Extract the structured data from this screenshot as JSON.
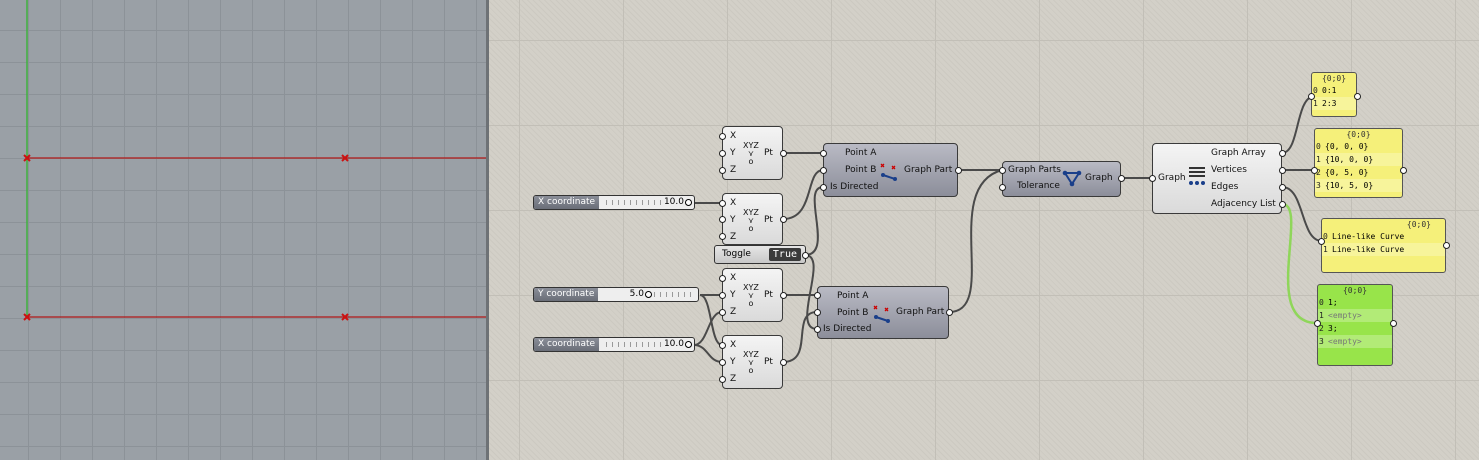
{
  "viewport": {
    "axis_color": "#3fb13f",
    "curve_color": "#b01818",
    "point_color": "#cc1111"
  },
  "sliders": [
    {
      "label": "X coordinate",
      "value": "10.0"
    },
    {
      "label": "Y coordinate",
      "value": "5.0"
    },
    {
      "label": "X coordinate",
      "value": "10.0"
    }
  ],
  "toggle": {
    "label": "Toggle",
    "value": "True"
  },
  "pt_nodes": {
    "inputs": [
      "X",
      "Y",
      "Z"
    ],
    "output": "Pt"
  },
  "graph_part_a": {
    "inputs": [
      "Point A",
      "Point B",
      "Is Directed"
    ],
    "output": "Graph Part"
  },
  "graph_part_b": {
    "inputs": [
      "Point A",
      "Point B",
      "Is Directed"
    ],
    "output": "Graph Part"
  },
  "graph_node": {
    "inputs": [
      "Graph Parts",
      "Tolerance"
    ],
    "output": "Graph"
  },
  "deconstruct": {
    "input": "Graph",
    "outputs": [
      "Graph Array",
      "Vertices",
      "Edges",
      "Adjacency List"
    ]
  },
  "panels": {
    "graph_array": {
      "header": "{0;0}",
      "rows": [
        {
          "i": "0",
          "v": "0:1"
        },
        {
          "i": "1",
          "v": "2:3"
        }
      ]
    },
    "vertices": {
      "header": "{0;0}",
      "rows": [
        {
          "i": "0",
          "v": "{0, 0, 0}"
        },
        {
          "i": "1",
          "v": "{10, 0, 0}"
        },
        {
          "i": "2",
          "v": "{0, 5, 0}"
        },
        {
          "i": "3",
          "v": "{10, 5, 0}"
        }
      ]
    },
    "edges": {
      "header": "{0;0}",
      "rows": [
        {
          "i": "0",
          "v": "Line-like Curve"
        },
        {
          "i": "1",
          "v": "Line-like Curve"
        }
      ]
    },
    "adjacency": {
      "header": "{0;0}",
      "rows": [
        {
          "i": "0",
          "v": "1;"
        },
        {
          "i": "1",
          "v": "<empty>"
        },
        {
          "i": "2",
          "v": "3;"
        },
        {
          "i": "3",
          "v": "<empty>"
        }
      ]
    }
  },
  "colors": {
    "yellow_panel": "#f5f07a",
    "green_panel": "#98e44a",
    "wire": "#4a4a4a",
    "wire_selected": "#8fd65a"
  }
}
